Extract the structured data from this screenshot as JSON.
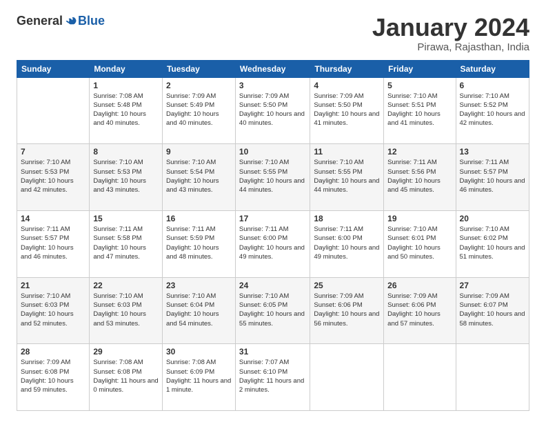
{
  "logo": {
    "general": "General",
    "blue": "Blue"
  },
  "title": "January 2024",
  "location": "Pirawa, Rajasthan, India",
  "headers": [
    "Sunday",
    "Monday",
    "Tuesday",
    "Wednesday",
    "Thursday",
    "Friday",
    "Saturday"
  ],
  "weeks": [
    [
      {
        "day": "",
        "sunrise": "",
        "sunset": "",
        "daylight": ""
      },
      {
        "day": "1",
        "sunrise": "Sunrise: 7:08 AM",
        "sunset": "Sunset: 5:48 PM",
        "daylight": "Daylight: 10 hours and 40 minutes."
      },
      {
        "day": "2",
        "sunrise": "Sunrise: 7:09 AM",
        "sunset": "Sunset: 5:49 PM",
        "daylight": "Daylight: 10 hours and 40 minutes."
      },
      {
        "day": "3",
        "sunrise": "Sunrise: 7:09 AM",
        "sunset": "Sunset: 5:50 PM",
        "daylight": "Daylight: 10 hours and 40 minutes."
      },
      {
        "day": "4",
        "sunrise": "Sunrise: 7:09 AM",
        "sunset": "Sunset: 5:50 PM",
        "daylight": "Daylight: 10 hours and 41 minutes."
      },
      {
        "day": "5",
        "sunrise": "Sunrise: 7:10 AM",
        "sunset": "Sunset: 5:51 PM",
        "daylight": "Daylight: 10 hours and 41 minutes."
      },
      {
        "day": "6",
        "sunrise": "Sunrise: 7:10 AM",
        "sunset": "Sunset: 5:52 PM",
        "daylight": "Daylight: 10 hours and 42 minutes."
      }
    ],
    [
      {
        "day": "7",
        "sunrise": "Sunrise: 7:10 AM",
        "sunset": "Sunset: 5:53 PM",
        "daylight": "Daylight: 10 hours and 42 minutes."
      },
      {
        "day": "8",
        "sunrise": "Sunrise: 7:10 AM",
        "sunset": "Sunset: 5:53 PM",
        "daylight": "Daylight: 10 hours and 43 minutes."
      },
      {
        "day": "9",
        "sunrise": "Sunrise: 7:10 AM",
        "sunset": "Sunset: 5:54 PM",
        "daylight": "Daylight: 10 hours and 43 minutes."
      },
      {
        "day": "10",
        "sunrise": "Sunrise: 7:10 AM",
        "sunset": "Sunset: 5:55 PM",
        "daylight": "Daylight: 10 hours and 44 minutes."
      },
      {
        "day": "11",
        "sunrise": "Sunrise: 7:10 AM",
        "sunset": "Sunset: 5:55 PM",
        "daylight": "Daylight: 10 hours and 44 minutes."
      },
      {
        "day": "12",
        "sunrise": "Sunrise: 7:11 AM",
        "sunset": "Sunset: 5:56 PM",
        "daylight": "Daylight: 10 hours and 45 minutes."
      },
      {
        "day": "13",
        "sunrise": "Sunrise: 7:11 AM",
        "sunset": "Sunset: 5:57 PM",
        "daylight": "Daylight: 10 hours and 46 minutes."
      }
    ],
    [
      {
        "day": "14",
        "sunrise": "Sunrise: 7:11 AM",
        "sunset": "Sunset: 5:57 PM",
        "daylight": "Daylight: 10 hours and 46 minutes."
      },
      {
        "day": "15",
        "sunrise": "Sunrise: 7:11 AM",
        "sunset": "Sunset: 5:58 PM",
        "daylight": "Daylight: 10 hours and 47 minutes."
      },
      {
        "day": "16",
        "sunrise": "Sunrise: 7:11 AM",
        "sunset": "Sunset: 5:59 PM",
        "daylight": "Daylight: 10 hours and 48 minutes."
      },
      {
        "day": "17",
        "sunrise": "Sunrise: 7:11 AM",
        "sunset": "Sunset: 6:00 PM",
        "daylight": "Daylight: 10 hours and 49 minutes."
      },
      {
        "day": "18",
        "sunrise": "Sunrise: 7:11 AM",
        "sunset": "Sunset: 6:00 PM",
        "daylight": "Daylight: 10 hours and 49 minutes."
      },
      {
        "day": "19",
        "sunrise": "Sunrise: 7:10 AM",
        "sunset": "Sunset: 6:01 PM",
        "daylight": "Daylight: 10 hours and 50 minutes."
      },
      {
        "day": "20",
        "sunrise": "Sunrise: 7:10 AM",
        "sunset": "Sunset: 6:02 PM",
        "daylight": "Daylight: 10 hours and 51 minutes."
      }
    ],
    [
      {
        "day": "21",
        "sunrise": "Sunrise: 7:10 AM",
        "sunset": "Sunset: 6:03 PM",
        "daylight": "Daylight: 10 hours and 52 minutes."
      },
      {
        "day": "22",
        "sunrise": "Sunrise: 7:10 AM",
        "sunset": "Sunset: 6:03 PM",
        "daylight": "Daylight: 10 hours and 53 minutes."
      },
      {
        "day": "23",
        "sunrise": "Sunrise: 7:10 AM",
        "sunset": "Sunset: 6:04 PM",
        "daylight": "Daylight: 10 hours and 54 minutes."
      },
      {
        "day": "24",
        "sunrise": "Sunrise: 7:10 AM",
        "sunset": "Sunset: 6:05 PM",
        "daylight": "Daylight: 10 hours and 55 minutes."
      },
      {
        "day": "25",
        "sunrise": "Sunrise: 7:09 AM",
        "sunset": "Sunset: 6:06 PM",
        "daylight": "Daylight: 10 hours and 56 minutes."
      },
      {
        "day": "26",
        "sunrise": "Sunrise: 7:09 AM",
        "sunset": "Sunset: 6:06 PM",
        "daylight": "Daylight: 10 hours and 57 minutes."
      },
      {
        "day": "27",
        "sunrise": "Sunrise: 7:09 AM",
        "sunset": "Sunset: 6:07 PM",
        "daylight": "Daylight: 10 hours and 58 minutes."
      }
    ],
    [
      {
        "day": "28",
        "sunrise": "Sunrise: 7:09 AM",
        "sunset": "Sunset: 6:08 PM",
        "daylight": "Daylight: 10 hours and 59 minutes."
      },
      {
        "day": "29",
        "sunrise": "Sunrise: 7:08 AM",
        "sunset": "Sunset: 6:08 PM",
        "daylight": "Daylight: 11 hours and 0 minutes."
      },
      {
        "day": "30",
        "sunrise": "Sunrise: 7:08 AM",
        "sunset": "Sunset: 6:09 PM",
        "daylight": "Daylight: 11 hours and 1 minute."
      },
      {
        "day": "31",
        "sunrise": "Sunrise: 7:07 AM",
        "sunset": "Sunset: 6:10 PM",
        "daylight": "Daylight: 11 hours and 2 minutes."
      },
      {
        "day": "",
        "sunrise": "",
        "sunset": "",
        "daylight": ""
      },
      {
        "day": "",
        "sunrise": "",
        "sunset": "",
        "daylight": ""
      },
      {
        "day": "",
        "sunrise": "",
        "sunset": "",
        "daylight": ""
      }
    ]
  ]
}
